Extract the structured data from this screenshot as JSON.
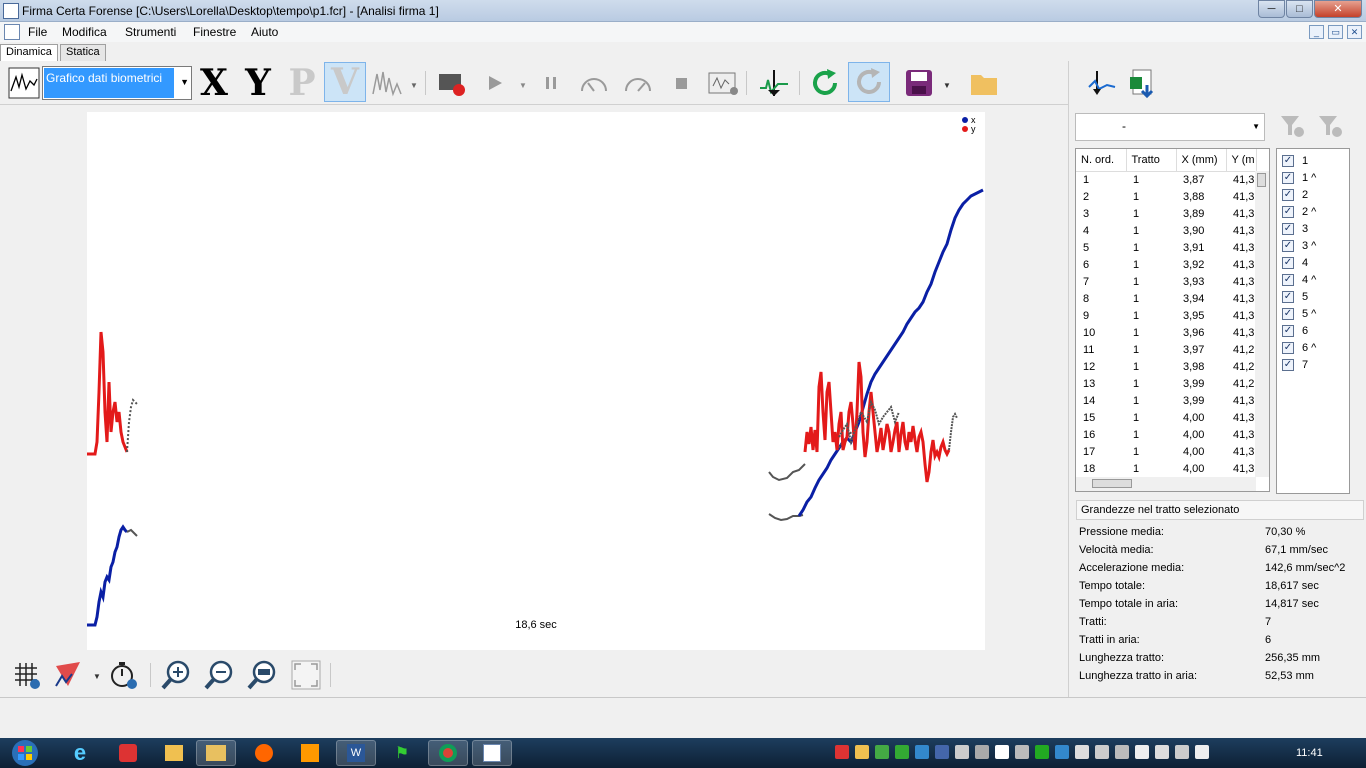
{
  "window": {
    "title": "Firma Certa Forense [C:\\Users\\Lorella\\Desktop\\tempo\\p1.fcr] - [Analisi firma 1]",
    "min": "─",
    "max": "□",
    "close": "✕"
  },
  "menu": {
    "items": [
      "File",
      "Modifica",
      "Strumenti",
      "Finestre",
      "Aiuto"
    ],
    "mdi": [
      "_",
      "▭",
      "✕"
    ]
  },
  "tabs": [
    "Dinamica",
    "Statica"
  ],
  "toolbar": {
    "chart_select": "Grafico dati biometrici",
    "letters": [
      "X",
      "Y",
      "P",
      "V"
    ]
  },
  "plot": {
    "time_label": "18,6 sec",
    "legend": [
      "x",
      "y"
    ],
    "colors": {
      "x": "#0a1fa5",
      "y": "#e31a1a",
      "air": "#555555"
    }
  },
  "right": {
    "filter_value": "-",
    "table_headers": [
      "N. ord.",
      "Tratto",
      "X (mm)",
      "Y (m"
    ],
    "rows": [
      [
        "1",
        "1",
        "3,87",
        "41,3"
      ],
      [
        "2",
        "1",
        "3,88",
        "41,3"
      ],
      [
        "3",
        "1",
        "3,89",
        "41,3"
      ],
      [
        "4",
        "1",
        "3,90",
        "41,3"
      ],
      [
        "5",
        "1",
        "3,91",
        "41,3"
      ],
      [
        "6",
        "1",
        "3,92",
        "41,3"
      ],
      [
        "7",
        "1",
        "3,93",
        "41,3"
      ],
      [
        "8",
        "1",
        "3,94",
        "41,3"
      ],
      [
        "9",
        "1",
        "3,95",
        "41,3"
      ],
      [
        "10",
        "1",
        "3,96",
        "41,3"
      ],
      [
        "11",
        "1",
        "3,97",
        "41,2"
      ],
      [
        "12",
        "1",
        "3,98",
        "41,2"
      ],
      [
        "13",
        "1",
        "3,99",
        "41,2"
      ],
      [
        "14",
        "1",
        "3,99",
        "41,3"
      ],
      [
        "15",
        "1",
        "4,00",
        "41,3"
      ],
      [
        "16",
        "1",
        "4,00",
        "41,3"
      ],
      [
        "17",
        "1",
        "4,00",
        "41,3"
      ],
      [
        "18",
        "1",
        "4,00",
        "41,3"
      ]
    ],
    "checklist": [
      "1",
      "1 ^",
      "2",
      "2 ^",
      "3",
      "3 ^",
      "4",
      "4 ^",
      "5",
      "5 ^",
      "6",
      "6 ^",
      "7"
    ],
    "section_title": "Grandezze nel tratto selezionato",
    "stats": [
      {
        "label": "Pressione media:",
        "value": "70,30 %"
      },
      {
        "label": "Velocità media:",
        "value": "67,1 mm/sec"
      },
      {
        "label": "Accelerazione media:",
        "value": "142,6 mm/sec^2"
      },
      {
        "label": "Tempo totale:",
        "value": "18,617 sec"
      },
      {
        "label": "Tempo totale in aria:",
        "value": "14,817 sec"
      },
      {
        "label": "Tratti:",
        "value": "7"
      },
      {
        "label": "Tratti in aria:",
        "value": "6"
      },
      {
        "label": "Lunghezza tratto:",
        "value": "256,35 mm"
      },
      {
        "label": "Lunghezza tratto in aria:",
        "value": "52,53 mm"
      }
    ]
  },
  "taskbar": {
    "clock": "11:41"
  }
}
